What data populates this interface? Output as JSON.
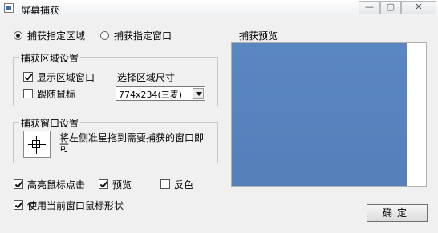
{
  "window": {
    "title": "屏幕捕获",
    "minimize": "—",
    "maximize": "▢",
    "close": "✕"
  },
  "mode": {
    "options": [
      {
        "label": "捕获指定区域",
        "selected": true
      },
      {
        "label": "捕获指定窗口",
        "selected": false
      }
    ]
  },
  "region_group": {
    "title": "捕获区域设置",
    "show_region_window": {
      "label": "显示区域窗口",
      "checked": true
    },
    "follow_mouse": {
      "label": "跟随鼠标",
      "checked": false
    },
    "size_label": "选择区域尺寸",
    "size_value": "774x234(三麦)"
  },
  "window_group": {
    "title": "捕获窗口设置",
    "hint": "将左侧准星拖到需要捕获的窗口即可"
  },
  "options": {
    "highlight_click": {
      "label": "高亮鼠标点击",
      "checked": true
    },
    "preview": {
      "label": "预览",
      "checked": true
    },
    "invert": {
      "label": "反色",
      "checked": false
    },
    "use_cursor_shape": {
      "label": "使用当前窗口鼠标形状",
      "checked": true
    }
  },
  "preview_panel": {
    "title": "捕获预览",
    "color": "#5a86c2"
  },
  "ok_button": "确定"
}
